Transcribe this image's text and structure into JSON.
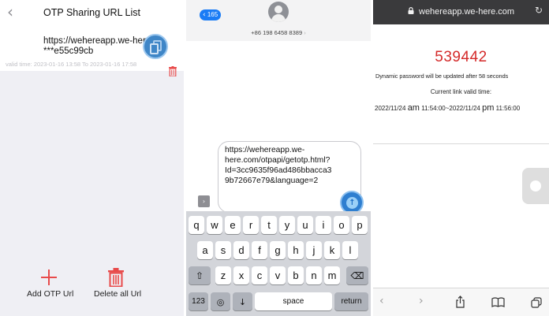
{
  "panel1": {
    "title": "OTP Sharing URL List",
    "back_icon": "chevron-left-icon",
    "item": {
      "url_line1": "https://wehereapp.we-her",
      "url_line2": "***e55c99cb",
      "valid_time": "valid time: 2023-01-16 13:58 To 2023-01-16 17:58"
    },
    "add_label": "Add OTP Url",
    "delete_all_label": "Delete all Url",
    "accent_color": "#e84a4a",
    "highlight_color": "#3f86c7"
  },
  "panel2": {
    "back_count": "165",
    "phone_number": "+86 198 6458 8389",
    "message_lines": [
      "https://wehereapp.we-",
      "here.com/otpapi/getotp.html?",
      "Id=3cc9635f96ad486bbacca3",
      "9b72667e79&language=2"
    ],
    "keyboard": {
      "row1": [
        "q",
        "w",
        "e",
        "r",
        "t",
        "y",
        "u",
        "i",
        "o",
        "p"
      ],
      "row2": [
        "a",
        "s",
        "d",
        "f",
        "g",
        "h",
        "j",
        "k",
        "l"
      ],
      "row3": [
        "z",
        "x",
        "c",
        "v",
        "b",
        "n",
        "m"
      ],
      "numbers_label": "123",
      "space_label": "space",
      "return_label": "return"
    }
  },
  "panel3": {
    "domain": "wehereapp.we-here.com",
    "otp_code": "539442",
    "dynamic_notice": "Dynamic password will be updated after 58 seconds",
    "current_link_label": "Current link valid time:",
    "range_start_date": "2022/11/24",
    "range_start_ampm": "am",
    "range_start_time": "11:54:00~2022/11/24",
    "range_end_ampm": "pm",
    "range_end_time": "11:56:00",
    "code_color": "#d42a2a"
  }
}
